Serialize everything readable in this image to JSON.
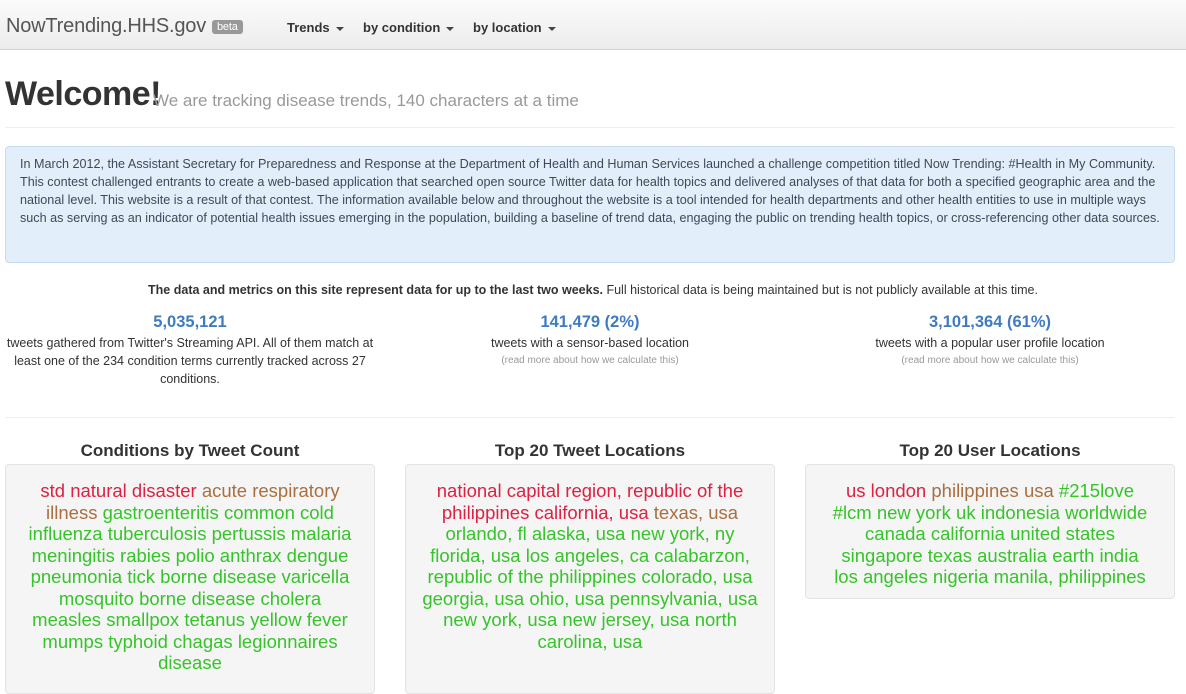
{
  "nav": {
    "brand": "NowTrending.HHS.gov",
    "beta": "beta",
    "menus": [
      "Trends",
      "by condition",
      "by location"
    ]
  },
  "header": {
    "welcome": "Welcome!",
    "tagline": "We are tracking disease trends, 140 characters at a time"
  },
  "info": "In March 2012, the Assistant Secretary for Preparedness and Response at the Department of Health and Human Services launched a challenge competition titled Now Trending: #Health in My Community. This contest challenged entrants to create a web-based application that searched open source Twitter data for health topics and delivered analyses of that data for both a specified geographic area and the national level. This website is a result of that contest. The information available below and throughout the website is a tool intended for health departments and other health entities to use in multiple ways such as serving as an indicator of potential health issues emerging in the population, building a baseline of trend data, engaging the public on trending health topics, or cross-referencing other data sources.",
  "data_note": {
    "bold": "The data and metrics on this site represent data for up to the last two weeks.",
    "rest": " Full historical data is being maintained but is not publicly available at this time."
  },
  "metrics": [
    {
      "value": "5,035,121",
      "desc": "tweets gathered from Twitter's Streaming API. All of them match at least one of the 234 condition terms currently tracked across 27 conditions.",
      "link": ""
    },
    {
      "value": "141,479 (2%)",
      "desc": "tweets with a sensor-based location",
      "link": "(read more about how we calculate this)"
    },
    {
      "value": "3,101,364 (61%)",
      "desc": "tweets with a popular user profile location",
      "link": "(read more about how we calculate this)"
    }
  ],
  "colors": {
    "red": "#dc2143",
    "brown": "#a87040",
    "green": "#36c42a",
    "blue": "#3f7bc1"
  },
  "panels": [
    {
      "title": "Conditions by Tweet Count",
      "tags": [
        {
          "t": "std",
          "c": "red"
        },
        {
          "t": "natural disaster",
          "c": "red"
        },
        {
          "t": "acute respiratory illness",
          "c": "brown"
        },
        {
          "t": "gastroenteritis",
          "c": "green"
        },
        {
          "t": "common cold",
          "c": "green"
        },
        {
          "t": "influenza",
          "c": "green"
        },
        {
          "t": "tuberculosis",
          "c": "green"
        },
        {
          "t": "pertussis",
          "c": "green"
        },
        {
          "t": "malaria",
          "c": "green"
        },
        {
          "t": "meningitis",
          "c": "green"
        },
        {
          "t": "rabies",
          "c": "green"
        },
        {
          "t": "polio",
          "c": "green"
        },
        {
          "t": "anthrax",
          "c": "green"
        },
        {
          "t": "dengue",
          "c": "green"
        },
        {
          "t": "pneumonia",
          "c": "green"
        },
        {
          "t": "tick borne disease",
          "c": "green"
        },
        {
          "t": "varicella",
          "c": "green"
        },
        {
          "t": "mosquito borne disease",
          "c": "green"
        },
        {
          "t": "cholera",
          "c": "green"
        },
        {
          "t": "measles",
          "c": "green"
        },
        {
          "t": "smallpox",
          "c": "green"
        },
        {
          "t": "tetanus",
          "c": "green"
        },
        {
          "t": "yellow fever",
          "c": "green"
        },
        {
          "t": "mumps",
          "c": "green"
        },
        {
          "t": "typhoid",
          "c": "green"
        },
        {
          "t": "chagas",
          "c": "green"
        },
        {
          "t": "legionnaires disease",
          "c": "green"
        }
      ]
    },
    {
      "title": "Top 20 Tweet Locations",
      "tags": [
        {
          "t": "national capital region, republic of the philippines",
          "c": "red"
        },
        {
          "t": "california, usa",
          "c": "red"
        },
        {
          "t": "texas, usa",
          "c": "brown"
        },
        {
          "t": "orlando, fl",
          "c": "green"
        },
        {
          "t": "alaska, usa",
          "c": "green"
        },
        {
          "t": "new york, ny",
          "c": "green"
        },
        {
          "t": "florida, usa",
          "c": "green"
        },
        {
          "t": "los angeles, ca",
          "c": "green"
        },
        {
          "t": "calabarzon, republic of the philippines",
          "c": "green"
        },
        {
          "t": "colorado, usa",
          "c": "green"
        },
        {
          "t": "georgia, usa",
          "c": "green"
        },
        {
          "t": "ohio, usa",
          "c": "green"
        },
        {
          "t": "pennsylvania, usa",
          "c": "green"
        },
        {
          "t": "new york, usa",
          "c": "green"
        },
        {
          "t": "new jersey, usa",
          "c": "green"
        },
        {
          "t": "north carolina, usa",
          "c": "green"
        }
      ]
    },
    {
      "title": "Top 20 User Locations",
      "tags": [
        {
          "t": "us",
          "c": "red"
        },
        {
          "t": "london",
          "c": "red"
        },
        {
          "t": "philippines",
          "c": "brown"
        },
        {
          "t": "usa",
          "c": "brown"
        },
        {
          "t": "#215love",
          "c": "green"
        },
        {
          "t": "#lcm",
          "c": "green"
        },
        {
          "t": "new york",
          "c": "green"
        },
        {
          "t": "uk",
          "c": "green"
        },
        {
          "t": "indonesia",
          "c": "green"
        },
        {
          "t": "worldwide",
          "c": "green"
        },
        {
          "t": "canada",
          "c": "green"
        },
        {
          "t": "california",
          "c": "green"
        },
        {
          "t": "united states",
          "c": "green"
        },
        {
          "t": "singapore",
          "c": "green"
        },
        {
          "t": "texas",
          "c": "green"
        },
        {
          "t": "australia",
          "c": "green"
        },
        {
          "t": "earth",
          "c": "green"
        },
        {
          "t": "india",
          "c": "green"
        },
        {
          "t": "los angeles",
          "c": "green"
        },
        {
          "t": "nigeria",
          "c": "green"
        },
        {
          "t": "manila, philippines",
          "c": "green"
        }
      ]
    }
  ]
}
